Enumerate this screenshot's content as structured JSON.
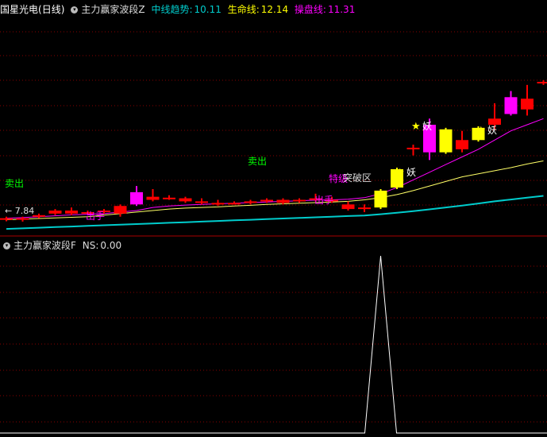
{
  "header": {
    "stock_name": "国星光电",
    "period": "(日线)",
    "indicator_name": "主力赢家波段Z",
    "ma_mid_label": "中线趋势:",
    "ma_mid_value": "10.11",
    "ma_life_label": "生命线:",
    "ma_life_value": "12.14",
    "ma_op_label": "操盘线:",
    "ma_op_value": "11.31"
  },
  "sub_header": {
    "indicator_name": "主力赢家波段F",
    "ns_label": "NS:",
    "ns_value": "0.00"
  },
  "colors": {
    "up": "#ff0000",
    "down": "#ff0000",
    "magenta": "#ff00ff",
    "yellow": "#ffff00",
    "ma_mid": "#00cccc",
    "ma_life": "#ffff66",
    "ma_op": "#ff00ff",
    "grid": "#880000",
    "label_green": "#00ff00",
    "label_magenta": "#ff00ff",
    "label_white": "#ffffff"
  },
  "annotations": {
    "sell_1": "卖出",
    "sell_2": "卖出",
    "out_1": "出手",
    "out_2": "出手",
    "special": "特级",
    "break": "突破区",
    "yao_1": "妖",
    "yao_2": "妖",
    "yao_3": "妖",
    "low_marker": "← 7.84"
  },
  "chart_data": {
    "type": "candlestick",
    "title": "国星光电(日线)",
    "ylim_main": [
      7.5,
      14.5
    ],
    "candles": [
      {
        "o": 7.95,
        "h": 8.0,
        "l": 7.85,
        "c": 7.9,
        "color": "red"
      },
      {
        "o": 7.9,
        "h": 8.0,
        "l": 7.84,
        "c": 7.95,
        "color": "red"
      },
      {
        "o": 8.0,
        "h": 8.1,
        "l": 7.95,
        "c": 8.05,
        "color": "red"
      },
      {
        "o": 8.1,
        "h": 8.25,
        "l": 8.05,
        "c": 8.2,
        "color": "red"
      },
      {
        "o": 8.1,
        "h": 8.3,
        "l": 8.05,
        "c": 8.2,
        "color": "red"
      },
      {
        "o": 8.15,
        "h": 8.2,
        "l": 8.1,
        "c": 8.15,
        "color": "red"
      },
      {
        "o": 8.2,
        "h": 8.25,
        "l": 8.1,
        "c": 8.2,
        "color": "red"
      },
      {
        "o": 8.1,
        "h": 8.4,
        "l": 8.0,
        "c": 8.35,
        "color": "red"
      },
      {
        "o": 8.4,
        "h": 9.0,
        "l": 8.35,
        "c": 8.8,
        "color": "magenta"
      },
      {
        "o": 8.55,
        "h": 8.9,
        "l": 8.5,
        "c": 8.65,
        "color": "red"
      },
      {
        "o": 8.6,
        "h": 8.7,
        "l": 8.55,
        "c": 8.62,
        "color": "red"
      },
      {
        "o": 8.6,
        "h": 8.65,
        "l": 8.45,
        "c": 8.5,
        "color": "red"
      },
      {
        "o": 8.5,
        "h": 8.6,
        "l": 8.4,
        "c": 8.45,
        "color": "red"
      },
      {
        "o": 8.45,
        "h": 8.55,
        "l": 8.35,
        "c": 8.4,
        "color": "red"
      },
      {
        "o": 8.45,
        "h": 8.5,
        "l": 8.4,
        "c": 8.45,
        "color": "red"
      },
      {
        "o": 8.5,
        "h": 8.55,
        "l": 8.4,
        "c": 8.45,
        "color": "red"
      },
      {
        "o": 8.55,
        "h": 8.6,
        "l": 8.45,
        "c": 8.5,
        "color": "red"
      },
      {
        "o": 8.55,
        "h": 8.6,
        "l": 8.4,
        "c": 8.45,
        "color": "red"
      },
      {
        "o": 8.55,
        "h": 8.6,
        "l": 8.45,
        "c": 8.5,
        "color": "red"
      },
      {
        "o": 8.6,
        "h": 8.75,
        "l": 8.5,
        "c": 8.55,
        "color": "red"
      },
      {
        "o": 8.55,
        "h": 8.65,
        "l": 8.45,
        "c": 8.5,
        "color": "red"
      },
      {
        "o": 8.4,
        "h": 8.5,
        "l": 8.2,
        "c": 8.25,
        "color": "red"
      },
      {
        "o": 8.3,
        "h": 8.4,
        "l": 8.15,
        "c": 8.25,
        "color": "red"
      },
      {
        "o": 8.3,
        "h": 8.9,
        "l": 8.25,
        "c": 8.85,
        "color": "yellow"
      },
      {
        "o": 8.95,
        "h": 9.6,
        "l": 8.9,
        "c": 9.55,
        "color": "yellow"
      },
      {
        "o": 10.2,
        "h": 10.35,
        "l": 10.0,
        "c": 10.25,
        "color": "red"
      },
      {
        "o": 10.1,
        "h": 11.2,
        "l": 9.85,
        "c": 11.0,
        "color": "magenta"
      },
      {
        "o": 10.1,
        "h": 10.9,
        "l": 10.05,
        "c": 10.85,
        "color": "yellow"
      },
      {
        "o": 10.5,
        "h": 10.8,
        "l": 10.1,
        "c": 10.2,
        "color": "red"
      },
      {
        "o": 10.5,
        "h": 10.95,
        "l": 10.45,
        "c": 10.9,
        "color": "yellow"
      },
      {
        "o": 11.0,
        "h": 11.7,
        "l": 10.85,
        "c": 11.2,
        "color": "red"
      },
      {
        "o": 11.35,
        "h": 12.1,
        "l": 11.3,
        "c": 11.9,
        "color": "magenta"
      },
      {
        "o": 11.5,
        "h": 12.3,
        "l": 11.3,
        "c": 11.85,
        "color": "red"
      },
      {
        "o": 12.4,
        "h": 12.45,
        "l": 12.3,
        "c": 12.4,
        "color": "red"
      }
    ],
    "series": [
      {
        "name": "中线趋势",
        "values": [
          7.6,
          7.62,
          7.64,
          7.66,
          7.68,
          7.7,
          7.72,
          7.74,
          7.76,
          7.78,
          7.8,
          7.82,
          7.84,
          7.86,
          7.88,
          7.9,
          7.92,
          7.94,
          7.96,
          7.98,
          8.0,
          8.02,
          8.04,
          8.08,
          8.13,
          8.18,
          8.24,
          8.3,
          8.36,
          8.43,
          8.5,
          8.56,
          8.62,
          8.68
        ]
      },
      {
        "name": "生命线",
        "values": [
          7.9,
          7.92,
          7.94,
          7.96,
          7.98,
          8.0,
          8.05,
          8.1,
          8.15,
          8.2,
          8.25,
          8.28,
          8.3,
          8.32,
          8.35,
          8.37,
          8.4,
          8.42,
          8.44,
          8.46,
          8.48,
          8.5,
          8.55,
          8.62,
          8.72,
          8.85,
          9.0,
          9.15,
          9.3,
          9.4,
          9.5,
          9.6,
          9.72,
          9.82
        ]
      },
      {
        "name": "操盘线",
        "values": [
          7.95,
          7.97,
          8.0,
          8.03,
          8.06,
          8.08,
          8.1,
          8.15,
          8.2,
          8.3,
          8.35,
          8.38,
          8.4,
          8.42,
          8.44,
          8.46,
          8.48,
          8.5,
          8.52,
          8.54,
          8.55,
          8.57,
          8.62,
          8.75,
          8.95,
          9.2,
          9.45,
          9.7,
          9.95,
          10.2,
          10.5,
          10.8,
          11.0,
          11.2
        ]
      }
    ],
    "sub_series": {
      "name": "NS",
      "values": [
        0,
        0,
        0,
        0,
        0,
        0,
        0,
        0,
        0,
        0,
        0,
        0,
        0,
        0,
        0,
        0,
        0,
        0,
        0,
        0,
        0,
        0,
        0,
        1,
        0,
        0,
        0,
        0,
        0,
        0,
        0,
        0,
        0,
        0
      ]
    },
    "ylim_sub": [
      0,
      1
    ]
  }
}
